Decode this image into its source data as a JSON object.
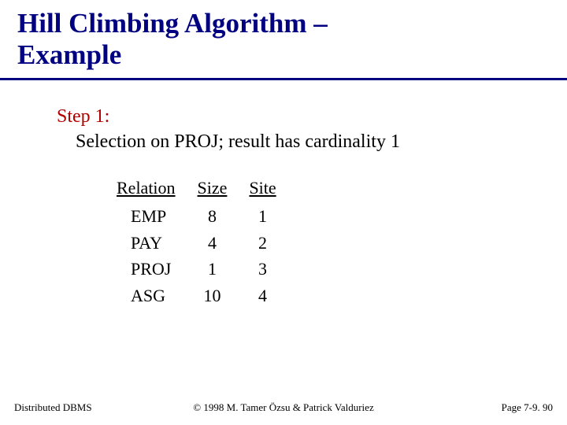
{
  "title_line1": "Hill Climbing Algorithm –",
  "title_line2": "Example",
  "step_label": "Step 1:",
  "step_desc": "Selection on PROJ; result has cardinality 1",
  "table": {
    "headers": {
      "relation": "Relation",
      "size": "Size",
      "site": "Site"
    },
    "rows": [
      {
        "relation": "EMP",
        "size": "8",
        "site": "1"
      },
      {
        "relation": "PAY",
        "size": "4",
        "site": "2"
      },
      {
        "relation": "PROJ",
        "size": "1",
        "site": "3"
      },
      {
        "relation": "ASG",
        "size": "10",
        "site": "4"
      }
    ]
  },
  "footer": {
    "left": "Distributed DBMS",
    "center": "© 1998 M. Tamer Özsu & Patrick Valduriez",
    "right": "Page 7-9. 90"
  }
}
